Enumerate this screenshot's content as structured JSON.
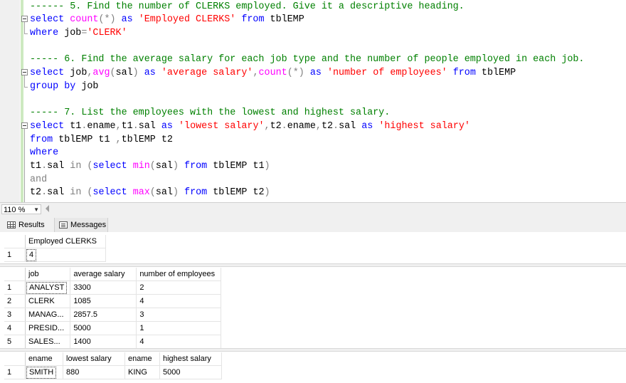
{
  "editor": {
    "lines": [
      [
        {
          "t": "------ 5. Find the number of CLERKS employed. Give it a descriptive heading.",
          "c": "cm"
        }
      ],
      [
        {
          "t": "select ",
          "c": "kw"
        },
        {
          "t": "count",
          "c": "fn"
        },
        {
          "t": "(*)",
          "c": "op"
        },
        {
          "t": " as ",
          "c": "kw"
        },
        {
          "t": "'Employed CLERKS'",
          "c": "str"
        },
        {
          "t": " from ",
          "c": "kw"
        },
        {
          "t": "tblEMP",
          "c": ""
        }
      ],
      [
        {
          "t": "where ",
          "c": "kw"
        },
        {
          "t": "job",
          "c": ""
        },
        {
          "t": "=",
          "c": "op"
        },
        {
          "t": "'CLERK'",
          "c": "str"
        }
      ],
      [],
      [
        {
          "t": "----- 6. Find the average salary for each job type and the number of people employed in each job.",
          "c": "cm"
        }
      ],
      [
        {
          "t": "select ",
          "c": "kw"
        },
        {
          "t": "job",
          "c": ""
        },
        {
          "t": ",",
          "c": "op"
        },
        {
          "t": "avg",
          "c": "fn"
        },
        {
          "t": "(",
          "c": "op"
        },
        {
          "t": "sal",
          "c": ""
        },
        {
          "t": ")",
          "c": "op"
        },
        {
          "t": " as ",
          "c": "kw"
        },
        {
          "t": "'average salary'",
          "c": "str"
        },
        {
          "t": ",",
          "c": "op"
        },
        {
          "t": "count",
          "c": "fn"
        },
        {
          "t": "(*)",
          "c": "op"
        },
        {
          "t": " as ",
          "c": "kw"
        },
        {
          "t": "'number of employees'",
          "c": "str"
        },
        {
          "t": " from ",
          "c": "kw"
        },
        {
          "t": "tblEMP",
          "c": ""
        }
      ],
      [
        {
          "t": "group by ",
          "c": "kw"
        },
        {
          "t": "job",
          "c": ""
        }
      ],
      [],
      [
        {
          "t": "----- 7. List the employees with the lowest and highest salary.",
          "c": "cm"
        }
      ],
      [
        {
          "t": "select ",
          "c": "kw"
        },
        {
          "t": "t1",
          "c": ""
        },
        {
          "t": ".",
          "c": "op"
        },
        {
          "t": "ename",
          "c": ""
        },
        {
          "t": ",",
          "c": "op"
        },
        {
          "t": "t1",
          "c": ""
        },
        {
          "t": ".",
          "c": "op"
        },
        {
          "t": "sal",
          "c": ""
        },
        {
          "t": " as ",
          "c": "kw"
        },
        {
          "t": "'lowest salary'",
          "c": "str"
        },
        {
          "t": ",",
          "c": "op"
        },
        {
          "t": "t2",
          "c": ""
        },
        {
          "t": ".",
          "c": "op"
        },
        {
          "t": "ename",
          "c": ""
        },
        {
          "t": ",",
          "c": "op"
        },
        {
          "t": "t2",
          "c": ""
        },
        {
          "t": ".",
          "c": "op"
        },
        {
          "t": "sal",
          "c": ""
        },
        {
          "t": " as ",
          "c": "kw"
        },
        {
          "t": "'highest salary'",
          "c": "str"
        }
      ],
      [
        {
          "t": "from ",
          "c": "kw"
        },
        {
          "t": "tblEMP t1 ",
          "c": ""
        },
        {
          "t": ",",
          "c": "op"
        },
        {
          "t": "tblEMP t2",
          "c": ""
        }
      ],
      [
        {
          "t": "where",
          "c": "kw"
        }
      ],
      [
        {
          "t": "t1",
          "c": ""
        },
        {
          "t": ".",
          "c": "op"
        },
        {
          "t": "sal ",
          "c": ""
        },
        {
          "t": "in ",
          "c": "op"
        },
        {
          "t": "(",
          "c": "op"
        },
        {
          "t": "select ",
          "c": "kw"
        },
        {
          "t": "min",
          "c": "fn"
        },
        {
          "t": "(",
          "c": "op"
        },
        {
          "t": "sal",
          "c": ""
        },
        {
          "t": ")",
          "c": "op"
        },
        {
          "t": " from ",
          "c": "kw"
        },
        {
          "t": "tblEMP t1",
          "c": ""
        },
        {
          "t": ")",
          "c": "op"
        }
      ],
      [
        {
          "t": "and",
          "c": "op"
        }
      ],
      [
        {
          "t": "t2",
          "c": ""
        },
        {
          "t": ".",
          "c": "op"
        },
        {
          "t": "sal ",
          "c": ""
        },
        {
          "t": "in ",
          "c": "op"
        },
        {
          "t": "(",
          "c": "op"
        },
        {
          "t": "select ",
          "c": "kw"
        },
        {
          "t": "max",
          "c": "fn"
        },
        {
          "t": "(",
          "c": "op"
        },
        {
          "t": "sal",
          "c": ""
        },
        {
          "t": ")",
          "c": "op"
        },
        {
          "t": " from ",
          "c": "kw"
        },
        {
          "t": "tblEMP t2",
          "c": ""
        },
        {
          "t": ")",
          "c": "op"
        }
      ]
    ]
  },
  "status": {
    "zoom": "110 %"
  },
  "tabs": {
    "results": "Results",
    "messages": "Messages"
  },
  "results": {
    "grid1": {
      "columns": [
        "Employed CLERKS"
      ],
      "rows": [
        [
          "4"
        ]
      ]
    },
    "grid2": {
      "columns": [
        "job",
        "average salary",
        "number of employees"
      ],
      "rows": [
        [
          "ANALYST",
          "3300",
          "2"
        ],
        [
          "CLERK",
          "1085",
          "4"
        ],
        [
          "MANAG...",
          "2857.5",
          "3"
        ],
        [
          "PRESID...",
          "5000",
          "1"
        ],
        [
          "SALES...",
          "1400",
          "4"
        ]
      ]
    },
    "grid3": {
      "columns": [
        "ename",
        "lowest salary",
        "ename",
        "highest salary"
      ],
      "rows": [
        [
          "SMITH",
          "880",
          "KING",
          "5000"
        ]
      ]
    }
  },
  "colors": {
    "keyword": "#0000ff",
    "function": "#ff00ff",
    "string": "#ff0000",
    "comment": "#008000",
    "operator": "#808080"
  }
}
